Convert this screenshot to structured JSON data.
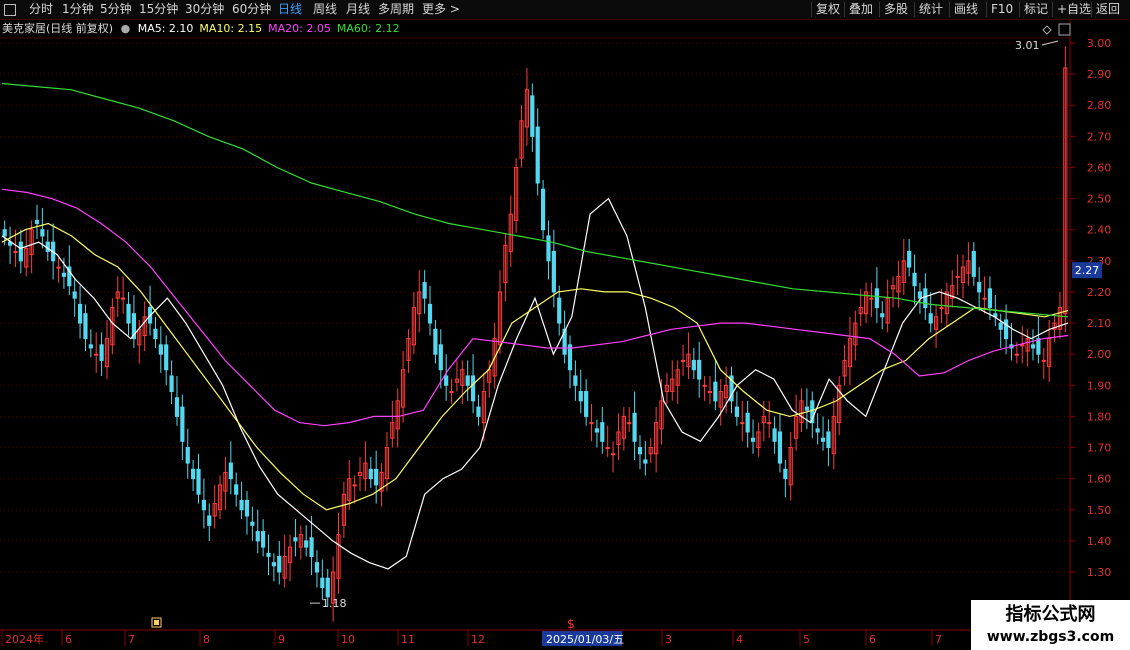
{
  "toolbar": {
    "left": [
      {
        "label": "分时",
        "active": false
      },
      {
        "label": "1分钟",
        "active": false
      },
      {
        "label": "5分钟",
        "active": false
      },
      {
        "label": "15分钟",
        "active": false
      },
      {
        "label": "30分钟",
        "active": false
      },
      {
        "label": "60分钟",
        "active": false
      },
      {
        "label": "日线",
        "active": true
      },
      {
        "label": "周线",
        "active": false
      },
      {
        "label": "月线",
        "active": false
      },
      {
        "label": "多周期",
        "active": false
      },
      {
        "label": "更多 >",
        "active": false
      }
    ],
    "right": [
      "复权",
      "叠加",
      "多股",
      "统计",
      "画线",
      "F10",
      "标记",
      "+自选",
      "返回"
    ]
  },
  "info": {
    "title": "美克家居(日线 前复权)",
    "ma": [
      {
        "label": "MA5: 2.10",
        "color": "#ffffff"
      },
      {
        "label": "MA10: 2.15",
        "color": "#ffff66"
      },
      {
        "label": "MA20: 2.05",
        "color": "#ff40ff"
      },
      {
        "label": "MA60: 2.12",
        "color": "#33dd33"
      }
    ]
  },
  "watermark": {
    "line1": "指标公式网",
    "line2": "www.zbgs3.com"
  },
  "chart_data": {
    "type": "candlestick",
    "ylim": [
      1.18,
      3.01
    ],
    "y_ticks": [
      "3.00",
      "2.90",
      "2.80",
      "2.70",
      "2.60",
      "2.50",
      "2.40",
      "2.30",
      "2.20",
      "2.10",
      "2.00",
      "1.90",
      "1.80",
      "1.70",
      "1.60",
      "1.50",
      "1.40",
      "1.30"
    ],
    "current_price": "2.27",
    "annotations": {
      "high": "3.01",
      "low": "1.18"
    },
    "x_labels": [
      "2024年",
      "6",
      "7",
      "8",
      "9",
      "10",
      "11",
      "12",
      "2025/01/03/五",
      "3",
      "4",
      "5",
      "6",
      "7"
    ],
    "highlight_label": "2025/01/03/五",
    "candles_close": [
      2.38,
      2.35,
      2.33,
      2.3,
      2.34,
      2.4,
      2.42,
      2.38,
      2.33,
      2.3,
      2.28,
      2.25,
      2.22,
      2.18,
      2.1,
      2.05,
      2.02,
      2.0,
      1.98,
      2.05,
      2.15,
      2.2,
      2.18,
      2.1,
      2.05,
      2.08,
      2.12,
      2.1,
      2.05,
      2.0,
      1.95,
      1.88,
      1.8,
      1.72,
      1.65,
      1.6,
      1.55,
      1.5,
      1.45,
      1.52,
      1.58,
      1.62,
      1.6,
      1.55,
      1.5,
      1.48,
      1.45,
      1.4,
      1.38,
      1.35,
      1.32,
      1.3,
      1.35,
      1.38,
      1.4,
      1.42,
      1.38,
      1.35,
      1.3,
      1.25,
      1.22,
      1.3,
      1.42,
      1.55,
      1.6,
      1.58,
      1.62,
      1.65,
      1.6,
      1.58,
      1.62,
      1.7,
      1.78,
      1.85,
      1.95,
      2.05,
      2.15,
      2.2,
      2.18,
      2.1,
      2.0,
      1.95,
      1.9,
      1.88,
      1.92,
      1.95,
      1.9,
      1.85,
      1.8,
      1.88,
      1.95,
      2.05,
      2.2,
      2.35,
      2.45,
      2.6,
      2.75,
      2.85,
      2.7,
      2.55,
      2.4,
      2.3,
      2.2,
      2.1,
      2.0,
      1.95,
      1.9,
      1.85,
      1.8,
      1.78,
      1.75,
      1.72,
      1.7,
      1.68,
      1.75,
      1.8,
      1.78,
      1.72,
      1.68,
      1.65,
      1.7,
      1.78,
      1.85,
      1.9,
      1.92,
      1.95,
      1.98,
      2.0,
      1.95,
      1.92,
      1.9,
      1.88,
      1.85,
      1.88,
      1.9,
      1.85,
      1.8,
      1.78,
      1.75,
      1.72,
      1.75,
      1.8,
      1.78,
      1.72,
      1.65,
      1.6,
      1.7,
      1.8,
      1.85,
      1.82,
      1.78,
      1.75,
      1.72,
      1.7,
      1.8,
      1.9,
      1.98,
      2.05,
      2.1,
      2.15,
      2.2,
      2.18,
      2.15,
      2.12,
      2.18,
      2.22,
      2.25,
      2.3,
      2.28,
      2.22,
      2.18,
      2.15,
      2.1,
      2.12,
      2.15,
      2.2,
      2.22,
      2.25,
      2.28,
      2.3,
      2.25,
      2.2,
      2.18,
      2.15,
      2.12,
      2.08,
      2.05,
      2.02,
      2.0,
      2.03,
      2.05,
      2.02,
      2.0,
      1.98,
      2.05,
      2.1,
      2.15,
      2.92
    ],
    "ma_series": [
      {
        "name": "MA5",
        "color": "#ffffff",
        "values": [
          2.38,
          2.34,
          2.36,
          2.32,
          2.24,
          2.18,
          2.1,
          2.05,
          2.12,
          2.18,
          2.1,
          2.0,
          1.9,
          1.76,
          1.64,
          1.55,
          1.5,
          1.45,
          1.4,
          1.36,
          1.33,
          1.31,
          1.35,
          1.55,
          1.6,
          1.63,
          1.7,
          1.9,
          2.05,
          2.18,
          2.0,
          2.12,
          2.45,
          2.5,
          2.38,
          2.15,
          1.85,
          1.75,
          1.72,
          1.8,
          1.9,
          1.95,
          1.92,
          1.82,
          1.78,
          1.92,
          1.85,
          1.8,
          1.95,
          2.1,
          2.18,
          2.2,
          2.18,
          2.15,
          2.12,
          2.08,
          2.05,
          2.08,
          2.1
        ]
      },
      {
        "name": "MA10",
        "color": "#ffff66",
        "values": [
          2.36,
          2.4,
          2.42,
          2.38,
          2.32,
          2.28,
          2.2,
          2.1,
          2.0,
          1.9,
          1.8,
          1.7,
          1.62,
          1.55,
          1.5,
          1.52,
          1.55,
          1.6,
          1.7,
          1.8,
          1.88,
          1.95,
          2.1,
          2.15,
          2.2,
          2.21,
          2.2,
          2.2,
          2.18,
          2.15,
          2.1,
          1.95,
          1.88,
          1.82,
          1.8,
          1.82,
          1.85,
          1.9,
          1.95,
          1.98,
          2.05,
          2.1,
          2.15,
          2.14,
          2.13,
          2.12,
          2.14
        ]
      },
      {
        "name": "MA20",
        "color": "#ff40ff",
        "values": [
          2.53,
          2.52,
          2.5,
          2.47,
          2.42,
          2.36,
          2.28,
          2.18,
          2.08,
          1.98,
          1.9,
          1.82,
          1.78,
          1.77,
          1.78,
          1.8,
          1.8,
          1.82,
          1.95,
          2.05,
          2.04,
          2.03,
          2.02,
          2.02,
          2.03,
          2.04,
          2.06,
          2.08,
          2.09,
          2.1,
          2.1,
          2.09,
          2.08,
          2.07,
          2.06,
          2.05,
          2.0,
          1.93,
          1.94,
          1.98,
          2.01,
          2.03,
          2.05,
          2.06
        ]
      },
      {
        "name": "MA60",
        "color": "#33dd33",
        "values": [
          2.87,
          2.86,
          2.85,
          2.82,
          2.79,
          2.75,
          2.7,
          2.66,
          2.6,
          2.55,
          2.52,
          2.49,
          2.45,
          2.42,
          2.4,
          2.38,
          2.36,
          2.33,
          2.31,
          2.29,
          2.27,
          2.25,
          2.23,
          2.21,
          2.2,
          2.19,
          2.18,
          2.16,
          2.15,
          2.14,
          2.13,
          2.12
        ]
      }
    ]
  }
}
